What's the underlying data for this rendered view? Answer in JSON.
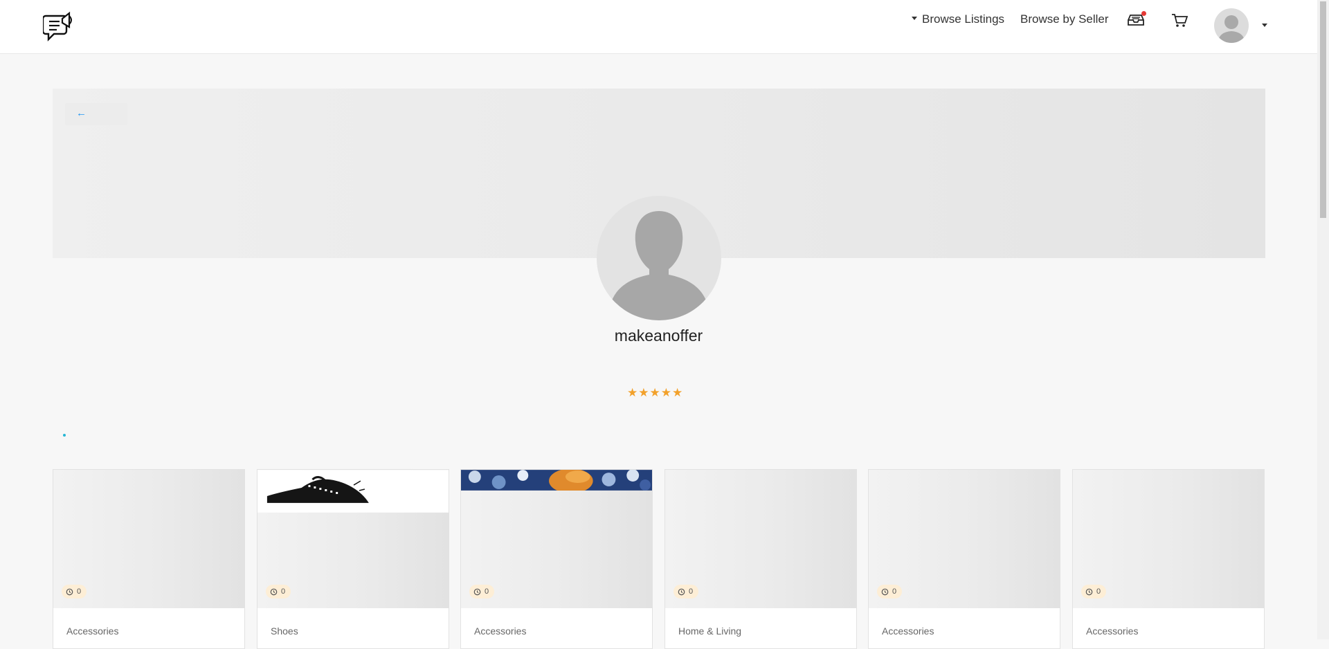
{
  "nav": {
    "browse_listings": "Browse Listings",
    "browse_by_seller": "Browse by Seller"
  },
  "back": {
    "label": "←"
  },
  "profile": {
    "username": "makeanoffer",
    "rating_stars": "★★★★★",
    "rating": 5
  },
  "colors": {
    "accent": "#2196f3",
    "star": "#f2a12b",
    "badge_bg": "#fdeed6",
    "notification_dot": "#e53935"
  },
  "listings": [
    {
      "category": "Accessories",
      "count": "0"
    },
    {
      "category": "Shoes",
      "count": "0"
    },
    {
      "category": "Accessories",
      "count": "0"
    },
    {
      "category": "Home & Living",
      "count": "0"
    },
    {
      "category": "Accessories",
      "count": "0"
    },
    {
      "category": "Accessories",
      "count": "0"
    }
  ]
}
